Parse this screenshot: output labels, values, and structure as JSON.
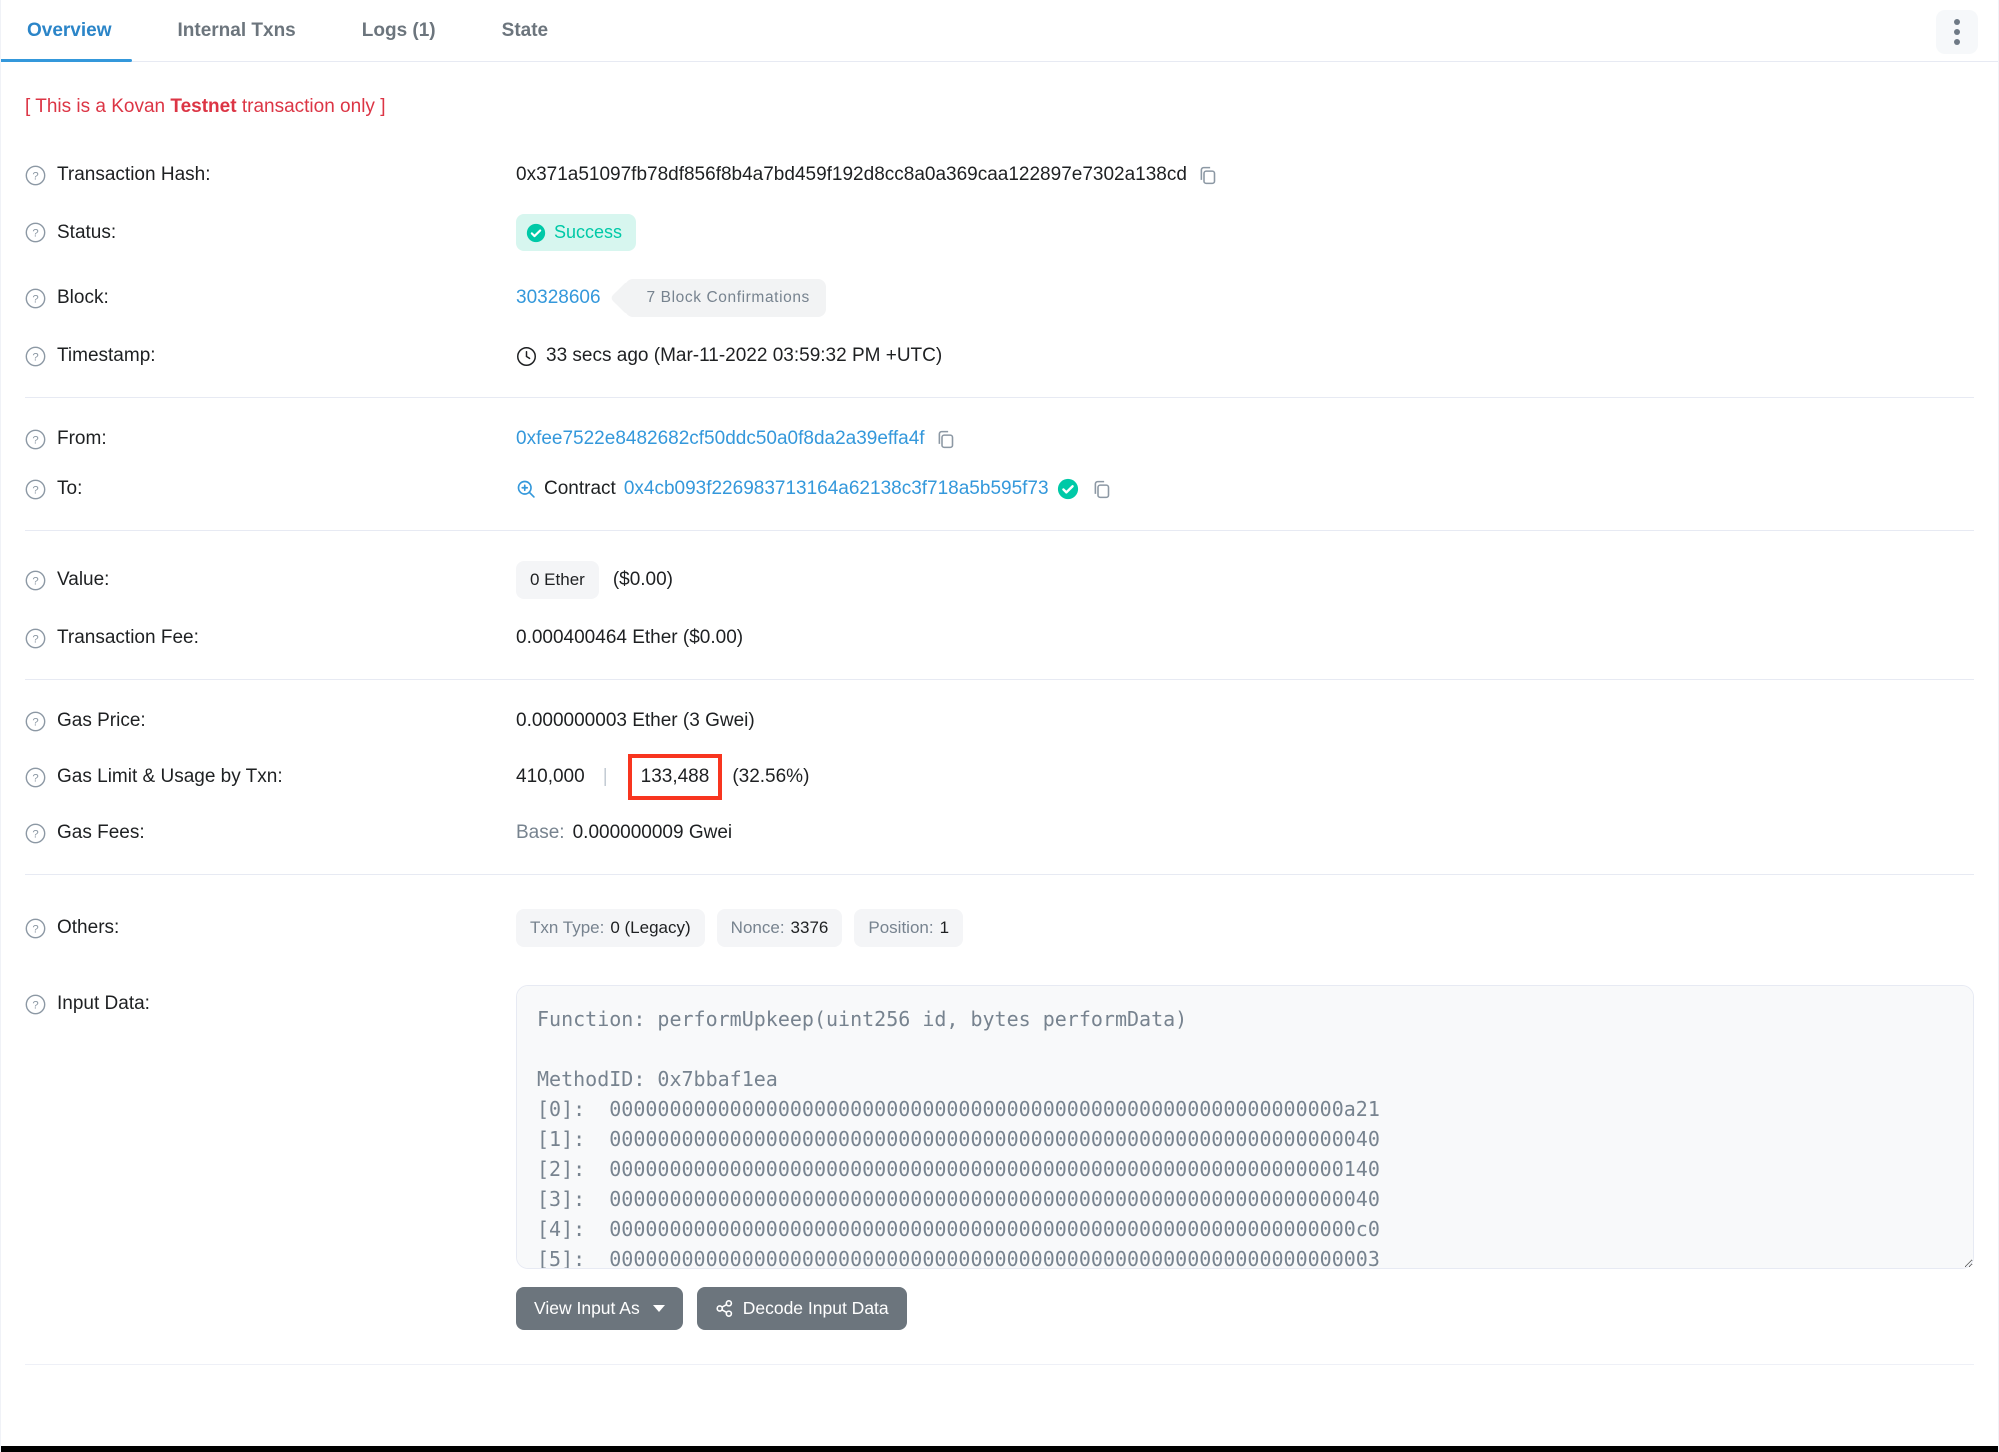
{
  "tabs": {
    "overview": "Overview",
    "internal": "Internal Txns",
    "logs": "Logs (1)",
    "state": "State"
  },
  "warning": {
    "prefix": "[ This is a Kovan ",
    "bold": "Testnet",
    "suffix": " transaction only ]"
  },
  "rows": {
    "tx_hash": {
      "label": "Transaction Hash:",
      "value": "0x371a51097fb78df856f8b4a7bd459f192d8cc8a0a369caa122897e7302a138cd"
    },
    "status": {
      "label": "Status:",
      "value": "Success"
    },
    "block": {
      "label": "Block:",
      "number": "30328606",
      "confirmations": "7 Block Confirmations"
    },
    "timestamp": {
      "label": "Timestamp:",
      "value": "33 secs ago (Mar-11-2022 03:59:32 PM +UTC)"
    },
    "from": {
      "label": "From:",
      "address": "0xfee7522e8482682cf50ddc50a0f8da2a39effa4f"
    },
    "to": {
      "label": "To:",
      "type": "Contract",
      "address": "0x4cb093f226983713164a62138c3f718a5b595f73"
    },
    "value": {
      "label": "Value:",
      "badge": "0 Ether",
      "usd": "($0.00)"
    },
    "tx_fee": {
      "label": "Transaction Fee:",
      "value": "0.000400464 Ether ($0.00)"
    },
    "gas_price": {
      "label": "Gas Price:",
      "value": "0.000000003 Ether (3 Gwei)"
    },
    "gas_limit": {
      "label": "Gas Limit & Usage by Txn:",
      "limit": "410,000",
      "separator": "|",
      "used": "133,488",
      "percent": "(32.56%)"
    },
    "gas_fees": {
      "label": "Gas Fees:",
      "base_label": "Base:",
      "base_value": "0.000000009 Gwei"
    },
    "others": {
      "label": "Others:",
      "pills": [
        {
          "k": "Txn Type:",
          "v": "0 (Legacy)"
        },
        {
          "k": "Nonce:",
          "v": "3376"
        },
        {
          "k": "Position:",
          "v": "1"
        }
      ]
    },
    "input_data": {
      "label": "Input Data:",
      "content": "Function: performUpkeep(uint256 id, bytes performData)\n\nMethodID: 0x7bbaf1ea\n[0]:  0000000000000000000000000000000000000000000000000000000000000a21\n[1]:  0000000000000000000000000000000000000000000000000000000000000040\n[2]:  0000000000000000000000000000000000000000000000000000000000000140\n[3]:  0000000000000000000000000000000000000000000000000000000000000040\n[4]:  00000000000000000000000000000000000000000000000000000000000000c0\n[5]:  0000000000000000000000000000000000000000000000000000000000000003",
      "view_input_as": "View Input As",
      "decode_button": "Decode Input Data"
    }
  },
  "colors": {
    "link_blue": "#3498db",
    "success_teal": "#00c9a7",
    "warning_red": "#dc3545",
    "highlight_box_red": "#f8351f"
  }
}
